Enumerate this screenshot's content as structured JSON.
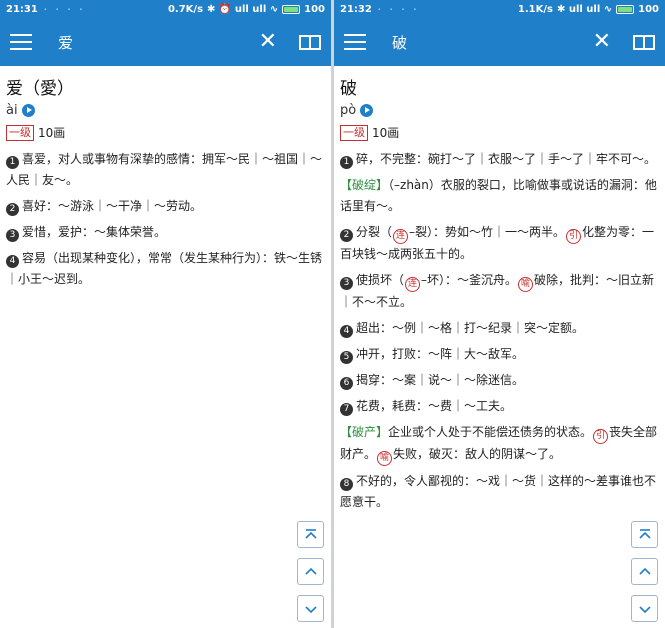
{
  "left": {
    "status": {
      "time": "21:31",
      "dots": "· · · ·",
      "net": "0.7K/s",
      "icons": "✱ ⏰ ull ull ∿",
      "battery": "100"
    },
    "appbar": {
      "title": "爱"
    },
    "head": "爱（愛）",
    "pinyin": "ài",
    "level": "一级",
    "strokes": "10画",
    "senses": [
      {
        "n": "1",
        "text": "喜爱，对人或事物有深挚的感情：拥军～民｜～祖国｜～人民｜友～。"
      },
      {
        "n": "2",
        "text": "喜好：～游泳｜～干净｜～劳动。"
      },
      {
        "n": "3",
        "text": "爱惜，爱护：～集体荣誉。"
      },
      {
        "n": "4",
        "text": "容易（出现某种变化），常常（发生某种行为）：铁～生锈｜小王～迟到。"
      }
    ]
  },
  "right": {
    "status": {
      "time": "21:32",
      "dots": "· · · ·",
      "net": "1.1K/s",
      "icons": "✱ ull ull ∿",
      "battery": "100"
    },
    "appbar": {
      "title": "破"
    },
    "head": "破",
    "pinyin": "pò",
    "level": "一级",
    "strokes": "10画",
    "s1": "碎，不完整：碗打～了｜衣服～了｜手～了｜牢不可～。",
    "p1_tag": "【破绽】",
    "p1_text": "（–zhàn）衣服的裂口，比喻做事或说话的漏洞：他话里有～。",
    "s2_a": "分裂（",
    "s2_lian": "连",
    "s2_b": "–裂）：势如～竹｜一～两半。",
    "s2_yin": "引",
    "s2_c": "化整为零：一百块钱～成两张五十的。",
    "s3_a": "使损坏（",
    "s3_lian": "连",
    "s3_b": "–坏）：～釜沉舟。",
    "s3_yu": "喻",
    "s3_c": "破除，批判：～旧立新｜不～不立。",
    "s4": "超出：～例｜～格｜打～纪录｜突～定额。",
    "s5": "冲开，打败：～阵｜大～敌军。",
    "s6": "揭穿：～案｜说～｜～除迷信。",
    "s7": "花费，耗费：～费｜～工夫。",
    "p2_tag": "【破产】",
    "p2_a": "企业或个人处于不能偿还债务的状态。",
    "p2_yin": "引",
    "p2_b": "丧失全部财产。",
    "p2_yu": "喻",
    "p2_c": "失败，破灭：敌人的阴谋～了。",
    "s8": "不好的，令人鄙视的：～戏｜～货｜这样的～差事谁也不愿意干。"
  },
  "colors": {
    "primary": "#1f80c9",
    "accent_red": "#c62f2f",
    "tag_green": "#2f8f3f"
  }
}
